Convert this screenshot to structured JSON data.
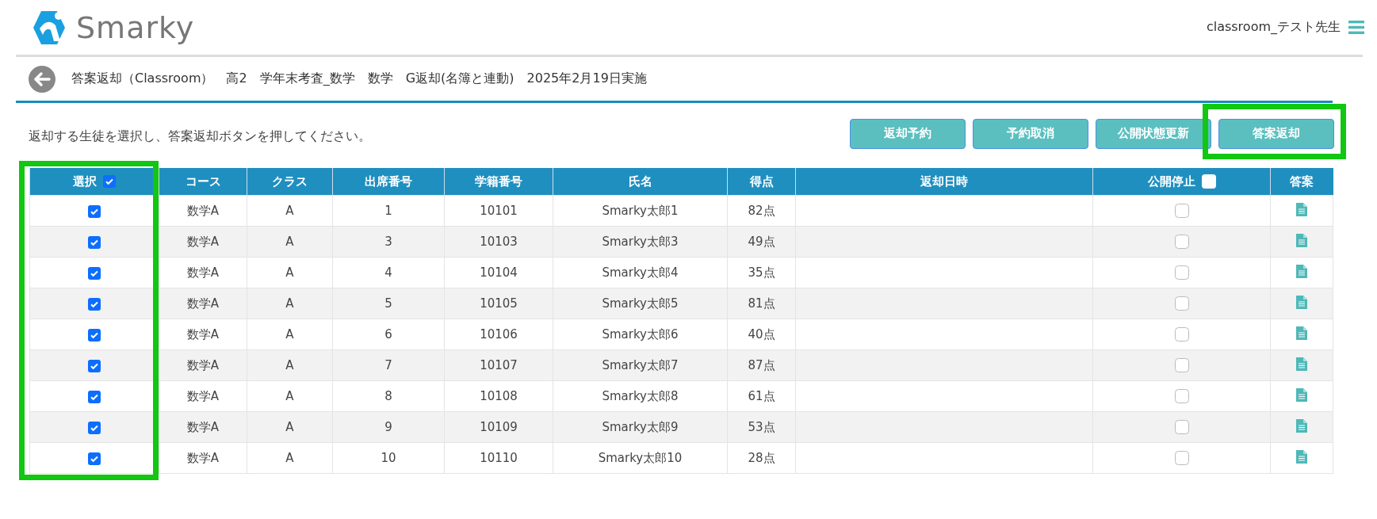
{
  "header": {
    "brand": "Smarky",
    "user": "classroom_テスト先生"
  },
  "breadcrumb": [
    "答案返却（Classroom）",
    "高2",
    "学年末考査_数学",
    "数学",
    "G返却(名簿と連動)",
    "2025年2月19日実施"
  ],
  "instruction": "返却する生徒を選択し、答案返却ボタンを押してください。",
  "buttons": [
    {
      "label": "返却予約",
      "highlighted": false
    },
    {
      "label": "予約取消",
      "highlighted": false
    },
    {
      "label": "公開状態更新",
      "highlighted": false
    },
    {
      "label": "答案返却",
      "highlighted": true
    }
  ],
  "table": {
    "select_column_highlighted": true,
    "columns": [
      {
        "label": "選択",
        "kind": "select",
        "checked": true
      },
      {
        "label": "コース",
        "kind": "text"
      },
      {
        "label": "クラス",
        "kind": "text"
      },
      {
        "label": "出席番号",
        "kind": "text"
      },
      {
        "label": "学籍番号",
        "kind": "text"
      },
      {
        "label": "氏名",
        "kind": "text"
      },
      {
        "label": "得点",
        "kind": "text"
      },
      {
        "label": "返却日時",
        "kind": "text"
      },
      {
        "label": "公開停止",
        "kind": "private",
        "checked": false
      },
      {
        "label": "答案",
        "kind": "doc"
      }
    ],
    "rows": [
      {
        "selected": true,
        "course": "数学A",
        "class": "A",
        "number": "1",
        "student_id": "10101",
        "name": "Smarky太郎1",
        "score": "82点",
        "private": false
      },
      {
        "selected": true,
        "course": "数学A",
        "class": "A",
        "number": "3",
        "student_id": "10103",
        "name": "Smarky太郎3",
        "score": "49点",
        "private": false
      },
      {
        "selected": true,
        "course": "数学A",
        "class": "A",
        "number": "4",
        "student_id": "10104",
        "name": "Smarky太郎4",
        "score": "35点",
        "private": false
      },
      {
        "selected": true,
        "course": "数学A",
        "class": "A",
        "number": "5",
        "student_id": "10105",
        "name": "Smarky太郎5",
        "score": "81点",
        "private": false
      },
      {
        "selected": true,
        "course": "数学A",
        "class": "A",
        "number": "6",
        "student_id": "10106",
        "name": "Smarky太郎6",
        "score": "40点",
        "private": false
      },
      {
        "selected": true,
        "course": "数学A",
        "class": "A",
        "number": "7",
        "student_id": "10107",
        "name": "Smarky太郎7",
        "score": "87点",
        "private": false
      },
      {
        "selected": true,
        "course": "数学A",
        "class": "A",
        "number": "8",
        "student_id": "10108",
        "name": "Smarky太郎8",
        "score": "61点",
        "private": false
      },
      {
        "selected": true,
        "course": "数学A",
        "class": "A",
        "number": "9",
        "student_id": "10109",
        "name": "Smarky太郎9",
        "score": "53点",
        "private": false
      },
      {
        "selected": true,
        "course": "数学A",
        "class": "A",
        "number": "10",
        "student_id": "10110",
        "name": "Smarky太郎10",
        "score": "28点",
        "private": false
      }
    ]
  }
}
